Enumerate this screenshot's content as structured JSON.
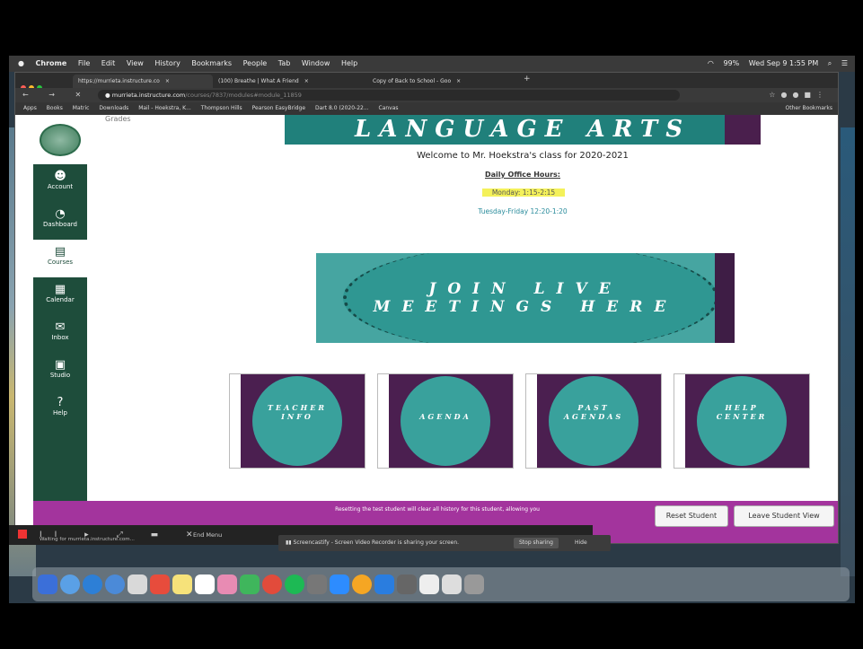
{
  "menubar": {
    "app": "Chrome",
    "items": [
      "File",
      "Edit",
      "View",
      "History",
      "Bookmarks",
      "People",
      "Tab",
      "Window",
      "Help"
    ],
    "battery": "99%",
    "clock": "Wed Sep 9 1:55 PM"
  },
  "tabs": [
    {
      "title": "https://murrieta.instructure.co",
      "close": "×"
    },
    {
      "title": "(100) Breathe | What A Friend",
      "close": "×"
    },
    {
      "title": "Copy of Back to School - Goo",
      "close": "×"
    }
  ],
  "new_tab": "+",
  "address": {
    "domain": "murrieta.instructure.com",
    "path": "/courses/7837/modules#module_11859",
    "nav_glyphs": "← → ✕"
  },
  "bookmarks": {
    "items": [
      "Apps",
      "Books",
      "Matric",
      "Downloads",
      "Mail - Hoekstra, K...",
      "Thompson Hills",
      "Pearson EasyBridge",
      "Dart 8.0 (2020-22...",
      "Canvas"
    ],
    "other": "Other Bookmarks"
  },
  "sidebar": {
    "items": [
      {
        "label": "Account",
        "icon": "☻"
      },
      {
        "label": "Dashboard",
        "icon": "◔"
      },
      {
        "label": "Courses",
        "icon": "▤"
      },
      {
        "label": "Calendar",
        "icon": "▦"
      },
      {
        "label": "Inbox",
        "icon": "✉"
      },
      {
        "label": "Studio",
        "icon": "▣"
      },
      {
        "label": "Help",
        "icon": "?"
      }
    ]
  },
  "course": {
    "grades_link": "Grades",
    "banner_title": "LANGUAGE ARTS",
    "welcome": "Welcome to Mr. Hoekstra's class for 2020-2021",
    "office_hours_title": "Daily Office Hours:",
    "monday": "Monday: 1:15-2:15",
    "tue_fri": "Tuesday-Friday 12:20-1:20",
    "live_line1": "JOIN LIVE",
    "live_line2": "MEETINGS HERE",
    "cards": [
      {
        "line1": "TEACHER",
        "line2": "INFO"
      },
      {
        "line1": "AGENDA",
        "line2": ""
      },
      {
        "line1": "PAST",
        "line2": "AGENDAS"
      },
      {
        "line1": "HELP",
        "line2": "CENTER"
      }
    ]
  },
  "student_view": {
    "message": "Resetting the test student will clear all history for this student, allowing you",
    "reset": "Reset Student",
    "leave": "Leave Student View"
  },
  "recorder": {
    "controls": "II ▸ ⤢ ▬ ✕",
    "end": "End Menu",
    "loading": "Waiting for murrieta.instructure.com..."
  },
  "notice": {
    "text": "Screencastify - Screen Video Recorder is sharing your screen.",
    "stop": "Stop sharing",
    "hide": "Hide"
  },
  "colors": {
    "canvas_nav": "#1e4d3b",
    "teal": "#39a19c",
    "purple": "#4b1f50",
    "student_bar": "#a3349d"
  }
}
